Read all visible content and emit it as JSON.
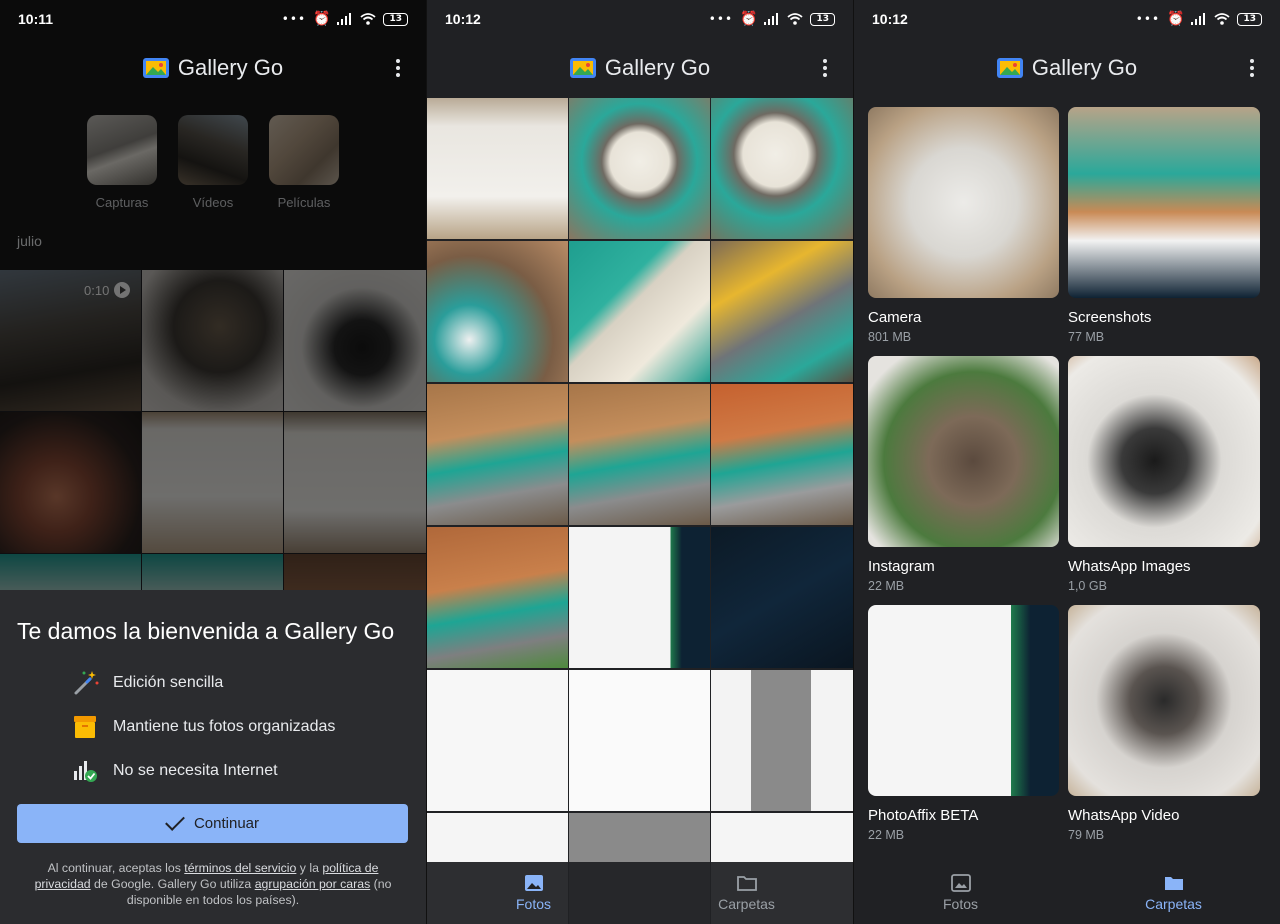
{
  "status_times": [
    "10:11",
    "10:12",
    "10:12"
  ],
  "battery": "13",
  "app": {
    "title": "Gallery Go"
  },
  "screen1": {
    "categories": [
      {
        "label": "Capturas"
      },
      {
        "label": "Vídeos"
      },
      {
        "label": "Películas"
      }
    ],
    "month": "julio",
    "video_duration": "0:10",
    "welcome": {
      "title": "Te damos la bienvenida a Gallery Go",
      "features": [
        {
          "icon": "magic-wand-icon",
          "text": "Edición sencilla"
        },
        {
          "icon": "organize-box-icon",
          "text": "Mantiene tus fotos organizadas"
        },
        {
          "icon": "offline-signal-icon",
          "text": "No se necesita Internet"
        }
      ],
      "continue_label": "Continuar",
      "legal_1": "Al continuar, aceptas los ",
      "legal_terms": "términos del servicio",
      "legal_2": " y la ",
      "legal_privacy": "política de privacidad",
      "legal_3": " de Google. Gallery Go utiliza ",
      "legal_faces": "agrupación por caras",
      "legal_4": " (no disponible en todos los países)."
    }
  },
  "screen2": {
    "nav": {
      "photos": "Fotos",
      "folders": "Carpetas"
    }
  },
  "screen3": {
    "folders": [
      {
        "name": "Camera",
        "size": "801 MB"
      },
      {
        "name": "Screenshots",
        "size": "77 MB"
      },
      {
        "name": "Instagram",
        "size": "22 MB"
      },
      {
        "name": "WhatsApp Images",
        "size": "1,0 GB"
      },
      {
        "name": "PhotoAffix BETA",
        "size": "22 MB"
      },
      {
        "name": "WhatsApp Video",
        "size": "79 MB"
      }
    ],
    "nav": {
      "photos": "Fotos",
      "folders": "Carpetas"
    }
  },
  "colors": {
    "accent": "#8ab4f8",
    "background": "#202124",
    "sheet": "#2b2c2f"
  }
}
